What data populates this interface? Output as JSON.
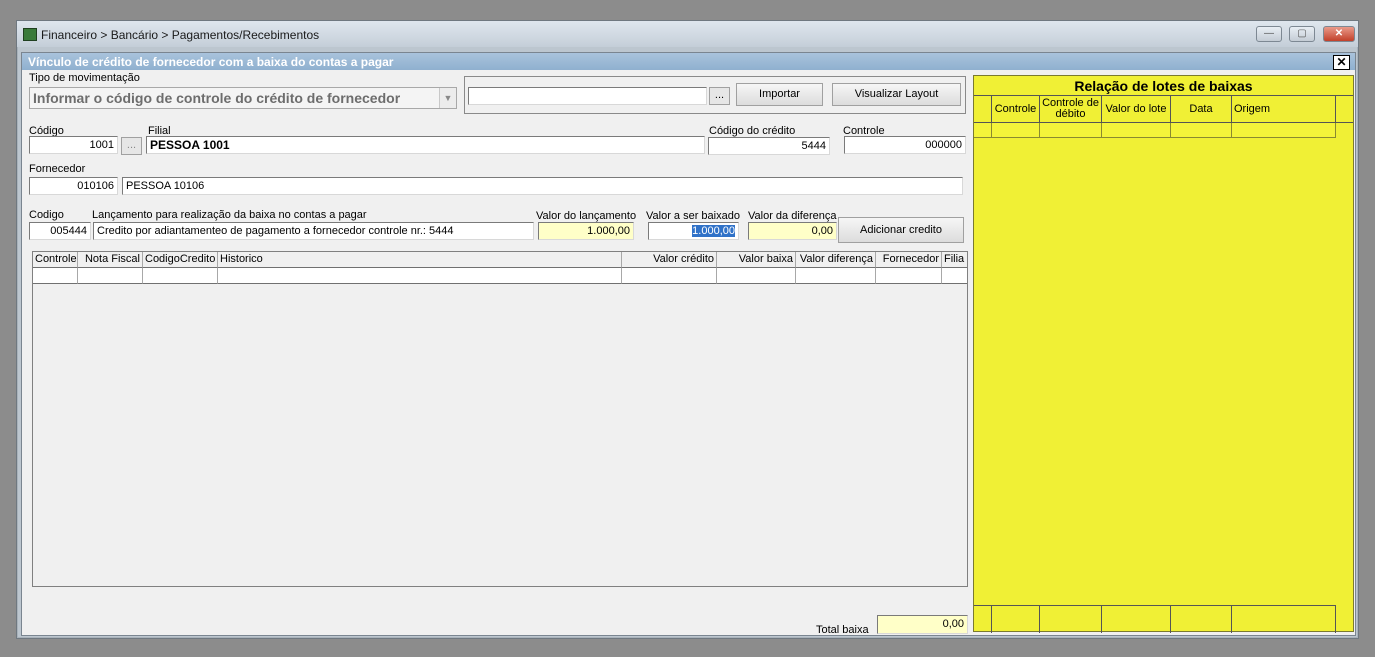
{
  "window": {
    "title": "Financeiro > Bancário > Pagamentos/Recebimentos",
    "min_label": "—",
    "max_label": "▢",
    "close_label": "✕"
  },
  "dialog": {
    "title": "Vínculo de crédito de fornecedor com a baixa do contas a pagar",
    "close_label": "✕"
  },
  "tipo": {
    "label": "Tipo de  movimentação",
    "value": "Informar o código de controle do crédito de fornecedor",
    "arrow": "▼"
  },
  "import": {
    "path_value": "",
    "browse_label": "...",
    "importar_label": "Importar",
    "visualizar_label": "Visualizar Layout"
  },
  "codigo": {
    "label": "Código",
    "value": "1001",
    "browse_label": "..."
  },
  "filial": {
    "label": "Filial",
    "value": "PESSOA 1001"
  },
  "codigo_credito": {
    "label": "Código do crédito",
    "value": "5444"
  },
  "controle": {
    "label": "Controle",
    "value": "000000"
  },
  "fornecedor": {
    "label": "Fornecedor",
    "code": "010106",
    "name": "PESSOA 10106"
  },
  "lancamento": {
    "codigo_label": "Codigo",
    "codigo_value": "005444",
    "desc_label": "Lançamento para realização da baixa no contas a pagar",
    "desc_value": "Credito por adiantamenteo de pagamento a fornecedor controle nr.: 5444",
    "valor_lanc_label": "Valor do lançamento",
    "valor_lanc_value": "1.000,00",
    "valor_baixar_label": "Valor a ser baixado",
    "valor_baixar_value": "1.000,00",
    "valor_dif_label": "Valor da diferença",
    "valor_dif_value": "0,00",
    "adicionar_label": "Adicionar credito"
  },
  "grid": {
    "columns": [
      "Controle",
      "Nota Fiscal",
      "CodigoCredito",
      "Historico",
      "Valor crédito",
      "Valor baixa",
      "Valor diferença",
      "Fornecedor",
      "Filia"
    ]
  },
  "total": {
    "label": "Total baixa",
    "value": "0,00"
  },
  "lotes": {
    "title": "Relação de lotes de baixas",
    "columns": [
      "Controle",
      "Controle de débito",
      "Valor do lote",
      "Data",
      "Origem"
    ]
  }
}
